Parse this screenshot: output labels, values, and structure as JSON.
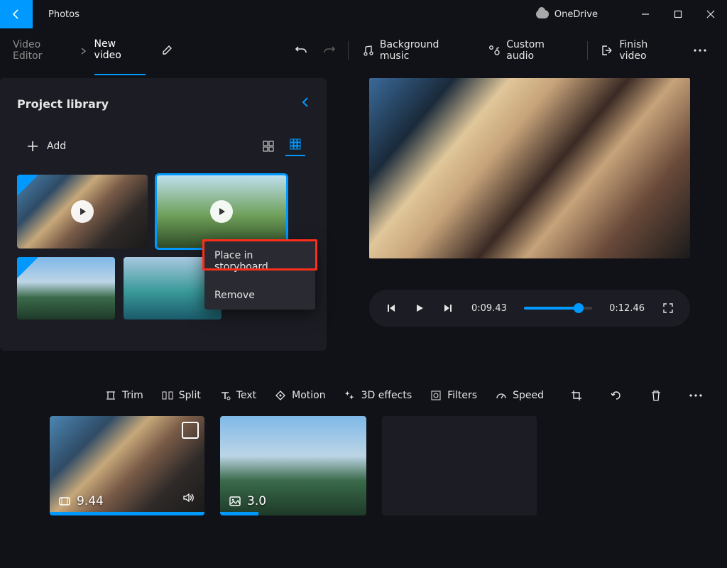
{
  "titlebar": {
    "app": "Photos",
    "onedrive": "OneDrive"
  },
  "cmdbar": {
    "breadcrumb": "Video Editor",
    "project_name": "New video",
    "bg_music": "Background music",
    "custom_audio": "Custom audio",
    "finish": "Finish video"
  },
  "library": {
    "title": "Project library",
    "add": "Add"
  },
  "context_menu": {
    "place": "Place in storyboard",
    "remove": "Remove"
  },
  "playback": {
    "current": "0:09.43",
    "total": "0:12.46"
  },
  "sb_tools": {
    "trim": "Trim",
    "split": "Split",
    "text": "Text",
    "motion": "Motion",
    "effects": "3D effects",
    "filters": "Filters",
    "speed": "Speed"
  },
  "clips": {
    "c1_duration": "9.44",
    "c2_duration": "3.0"
  }
}
